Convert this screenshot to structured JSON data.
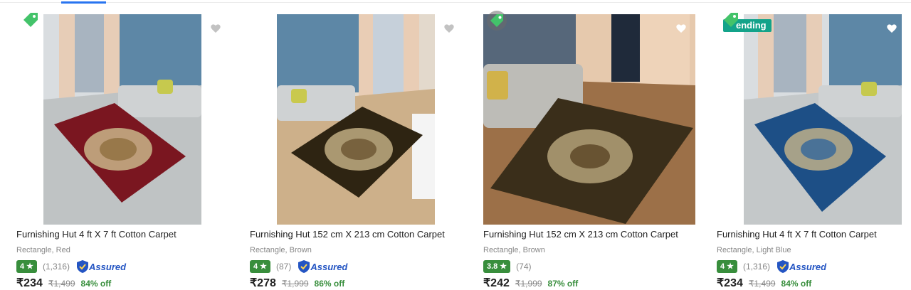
{
  "products": [
    {
      "title": "Furnishing Hut 4 ft X 7 ft Cotton Carpet",
      "variant": "Rectangle, Red",
      "rating": "4",
      "rating_count": "(1,316)",
      "assured_label": "Assured",
      "price": "₹234",
      "mrp": "₹1,499",
      "discount": "84% off",
      "carpet_color": "#7a1620",
      "badge": ""
    },
    {
      "title": "Furnishing Hut 152 cm X 213 cm Cotton Carpet",
      "variant": "Rectangle, Brown",
      "rating": "4",
      "rating_count": "(87)",
      "assured_label": "Assured",
      "price": "₹278",
      "mrp": "₹1,999",
      "discount": "86% off",
      "carpet_color": "#2e2412",
      "badge": ""
    },
    {
      "title": "Furnishing Hut 152 cm X 213 cm Cotton Carpet",
      "variant": "Rectangle, Brown",
      "rating": "3.8",
      "rating_count": "(74)",
      "assured_label": "",
      "price": "₹242",
      "mrp": "₹1,999",
      "discount": "87% off",
      "carpet_color": "#3a2e1a",
      "badge": ""
    },
    {
      "title": "Furnishing Hut 4 ft X 7 ft Cotton Carpet",
      "variant": "Rectangle, Light Blue",
      "rating": "4",
      "rating_count": "(1,316)",
      "assured_label": "Assured",
      "price": "₹234",
      "mrp": "₹1,499",
      "discount": "84% off",
      "carpet_color": "#1d4f86",
      "badge": "ending"
    }
  ],
  "colors": {
    "rating_green": "#388e3c",
    "assured_blue": "#2455c3",
    "trending_teal": "#13a38a"
  },
  "icons": [
    "heart-icon",
    "tag-icon",
    "star-icon",
    "assured-shield-icon"
  ]
}
